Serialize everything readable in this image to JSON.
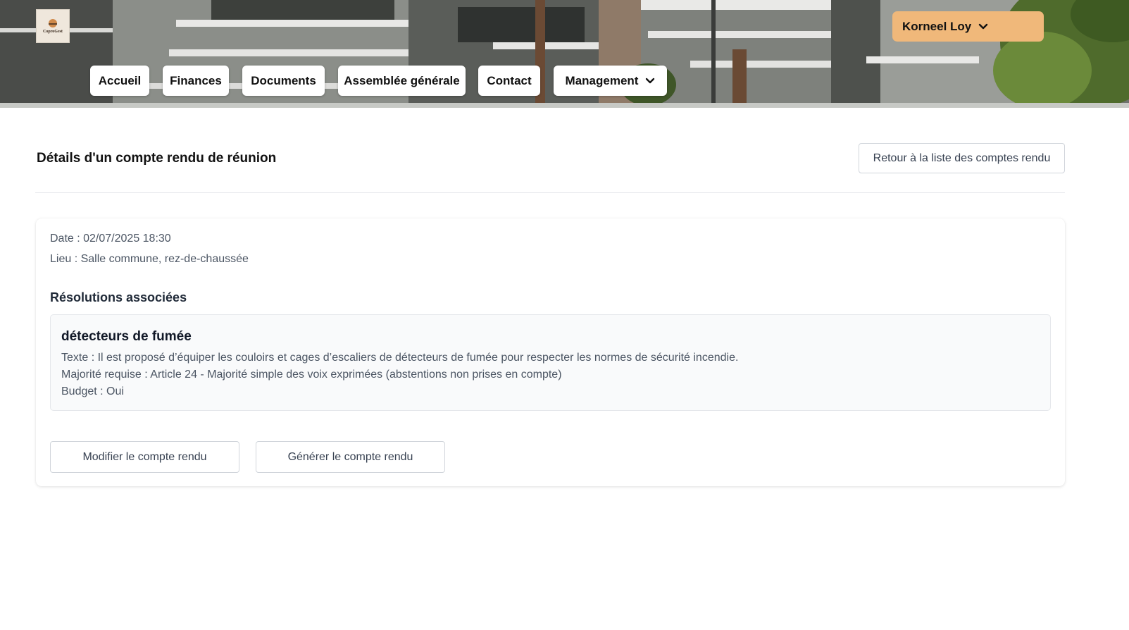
{
  "header": {
    "logo_text": "CoproGest",
    "user_name": "Korneel Loy",
    "user_accent": "#f0b87a",
    "nav": [
      {
        "label": "Accueil"
      },
      {
        "label": "Finances"
      },
      {
        "label": "Documents"
      },
      {
        "label": "Assemblée générale"
      },
      {
        "label": "Contact"
      },
      {
        "label": "Management",
        "icon": "chevron-down-icon"
      }
    ]
  },
  "page": {
    "title": "Détails d'un compte rendu de réunion",
    "back_button": "Retour à la liste des comptes rendu"
  },
  "meeting": {
    "date_line": "Date : 02/07/2025 18:30",
    "place_line": "Lieu : Salle commune, rez-de-chaussée",
    "resolutions_title": "Résolutions associées",
    "resolutions": [
      {
        "title": "détecteurs de fumée",
        "text_line": "Texte : Il est proposé d’équiper les couloirs et cages d’escaliers de détecteurs de fumée pour respecter les normes de sécurité incendie.",
        "majority_line": "Majorité requise : Article 24 - Majorité simple des voix exprimées (abstentions non prises en compte)",
        "budget_line": "Budget : Oui"
      }
    ]
  },
  "actions": {
    "edit_label": "Modifier le compte rendu",
    "generate_label": "Générer le compte rendu"
  }
}
